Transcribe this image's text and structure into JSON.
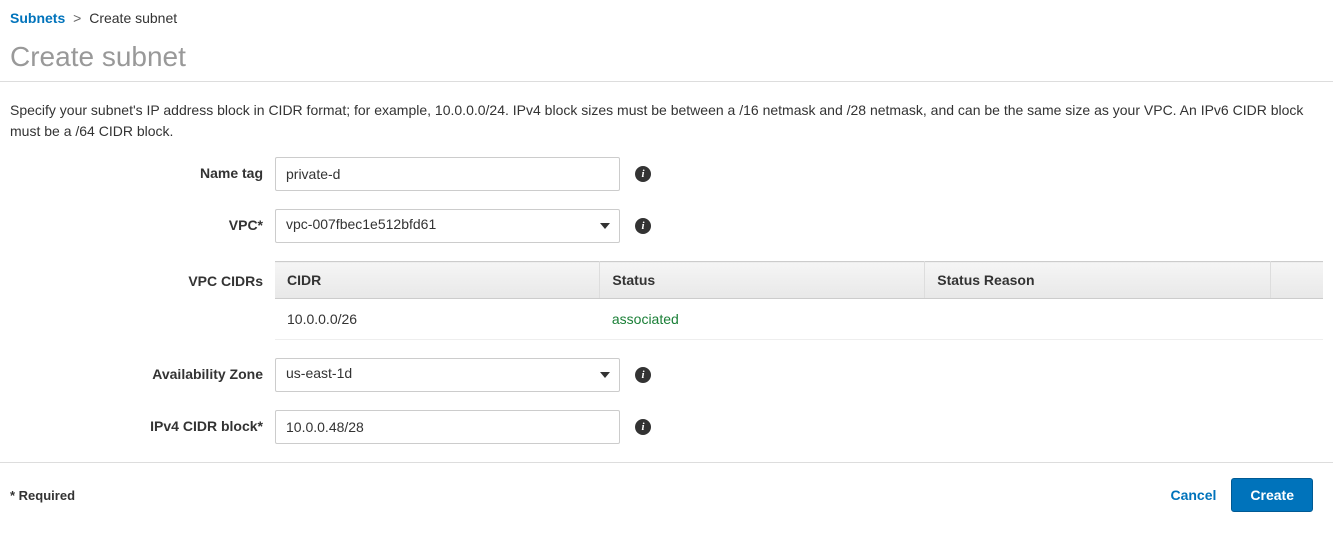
{
  "breadcrumb": {
    "parent": "Subnets",
    "current": "Create subnet"
  },
  "page_title": "Create subnet",
  "description": "Specify your subnet's IP address block in CIDR format; for example, 10.0.0.0/24. IPv4 block sizes must be between a /16 netmask and /28 netmask, and can be the same size as your VPC. An IPv6 CIDR block must be a /64 CIDR block.",
  "form": {
    "name_tag": {
      "label": "Name tag",
      "value": "private-d"
    },
    "vpc": {
      "label": "VPC*",
      "value": "vpc-007fbec1e512bfd61"
    },
    "vpc_cidrs": {
      "label": "VPC CIDRs",
      "headers": {
        "cidr": "CIDR",
        "status": "Status",
        "reason": "Status Reason"
      },
      "rows": [
        {
          "cidr": "10.0.0.0/26",
          "status": "associated",
          "reason": ""
        }
      ]
    },
    "availability_zone": {
      "label": "Availability Zone",
      "value": "us-east-1d"
    },
    "ipv4_cidr": {
      "label": "IPv4 CIDR block*",
      "value": "10.0.0.48/28"
    }
  },
  "footer": {
    "required_note": "* Required",
    "cancel": "Cancel",
    "create": "Create"
  }
}
